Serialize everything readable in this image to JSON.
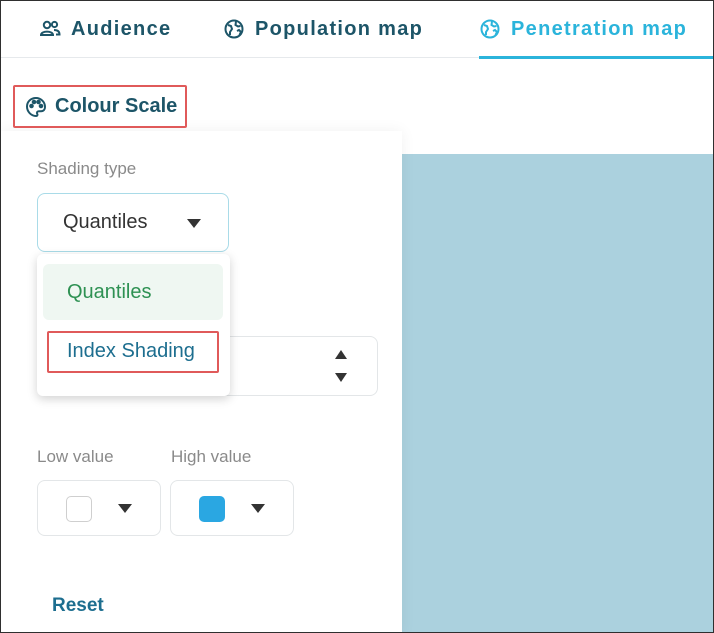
{
  "tabs": [
    {
      "label": "Audience",
      "icon": "people-icon",
      "active": false
    },
    {
      "label": "Population map",
      "icon": "globe-icon",
      "active": false
    },
    {
      "label": "Penetration map",
      "icon": "globe-icon",
      "active": true
    }
  ],
  "colour_scale": {
    "title": "Colour Scale",
    "icon": "palette-icon"
  },
  "shading": {
    "label": "Shading type",
    "selected": "Quantiles",
    "options": [
      "Quantiles",
      "Index Shading"
    ]
  },
  "low_value": {
    "label": "Low value",
    "color": "#ffffff"
  },
  "high_value": {
    "label": "High value",
    "color": "#2aa7e2"
  },
  "reset_label": "Reset",
  "colors": {
    "accent": "#2bb4db",
    "primary_text": "#1d5568",
    "map_fill": "#abd1de",
    "highlight": "#e05a5a",
    "selected_option": "#2e9153"
  }
}
